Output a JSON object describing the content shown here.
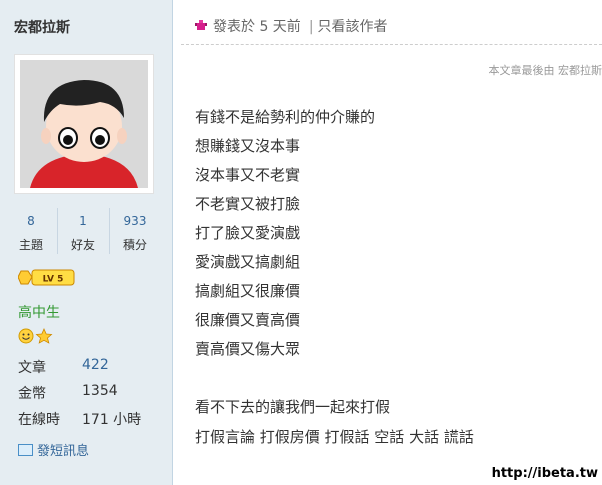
{
  "author": {
    "username": "宏都拉斯",
    "stats": [
      {
        "value": "8",
        "label": "主題"
      },
      {
        "value": "1",
        "label": "好友"
      },
      {
        "value": "933",
        "label": "積分"
      }
    ],
    "level_badge": "LV 5",
    "rank": "高中生",
    "info": [
      {
        "label": "文章",
        "value": "422",
        "unit": ""
      },
      {
        "label": "金幣",
        "value": "1354",
        "unit": ""
      },
      {
        "label": "在線時",
        "value": "171",
        "unit": " 小時"
      }
    ],
    "pm_label": "發短訊息"
  },
  "post": {
    "posted_prefix": "發表於",
    "posted_time": "5 天前",
    "only_author": "只看該作者",
    "edited_note": "本文章最後由 宏都拉斯",
    "lines": [
      "有錢不是給勢利的仲介賺的",
      "想賺錢又沒本事",
      "沒本事又不老實",
      "不老實又被打臉",
      "打了臉又愛演戲",
      "愛演戲又搞劇組",
      "搞劇組又很廉價",
      "很廉價又賣高價",
      "賣高價又傷大眾",
      "",
      "看不下去的讓我們一起來打假",
      "打假言論 打假房價 打假話 空話 大話 謊話"
    ]
  },
  "watermark": "http://ibeta.tw",
  "colors": {
    "sidebar_bg": "#e5edf2",
    "link": "#336699",
    "rank": "#339933"
  },
  "icons": [
    "online-status-icon",
    "level-badge-icon",
    "smiley-medal-icon",
    "star-medal-icon",
    "envelope-icon"
  ]
}
